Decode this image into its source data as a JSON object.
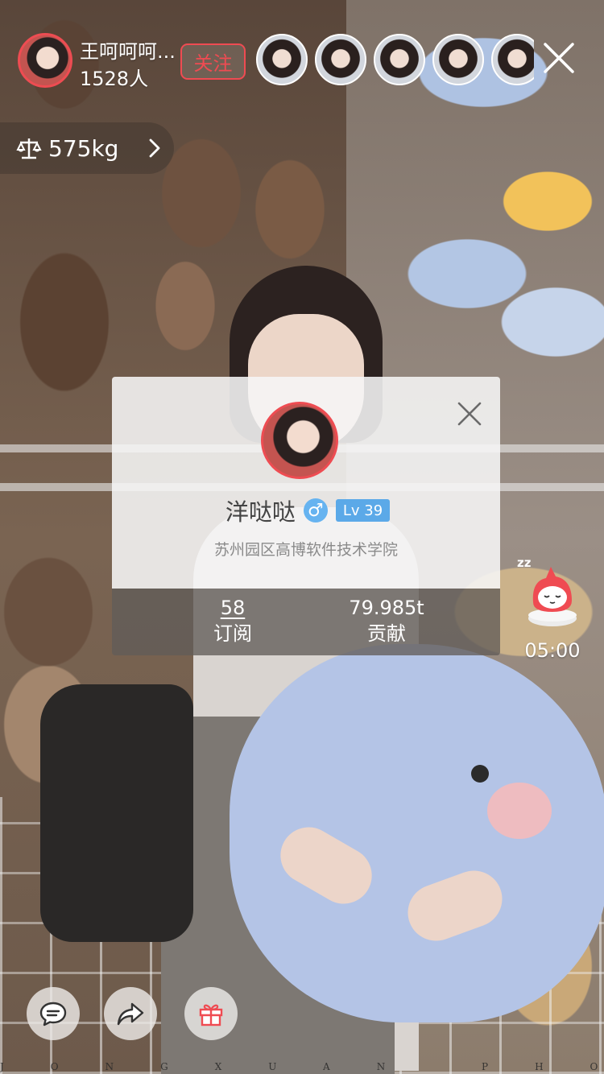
{
  "host": {
    "name": "王呵呵呵...",
    "viewer_count": "1528人",
    "follow_label": "关注"
  },
  "weight": {
    "value": "575kg",
    "icon": "scale-icon"
  },
  "viewers": [
    {
      "icon": "viewer-avatar"
    },
    {
      "icon": "viewer-avatar"
    },
    {
      "icon": "viewer-avatar"
    },
    {
      "icon": "viewer-avatar"
    },
    {
      "icon": "viewer-avatar"
    }
  ],
  "profile_card": {
    "name": "洋哒哒",
    "gender_symbol": "♂",
    "level": "Lv 39",
    "school": "苏州园区高博软件技术学院",
    "stats": [
      {
        "value": "58",
        "label": "订阅"
      },
      {
        "value": "79.985t",
        "label": "贡献"
      }
    ]
  },
  "sleep_widget": {
    "z_text": "zz",
    "timer": "05:00"
  },
  "toolbar": {
    "icons": [
      "chat-bubble-icon",
      "share-arrow-icon",
      "gift-icon"
    ]
  },
  "watermark": "JONGXUAN PHOTOGRAPHY",
  "colors": {
    "accent_red": "#ef4b52",
    "level_blue": "#5ba9e8",
    "gender_blue": "#66b3f0"
  }
}
